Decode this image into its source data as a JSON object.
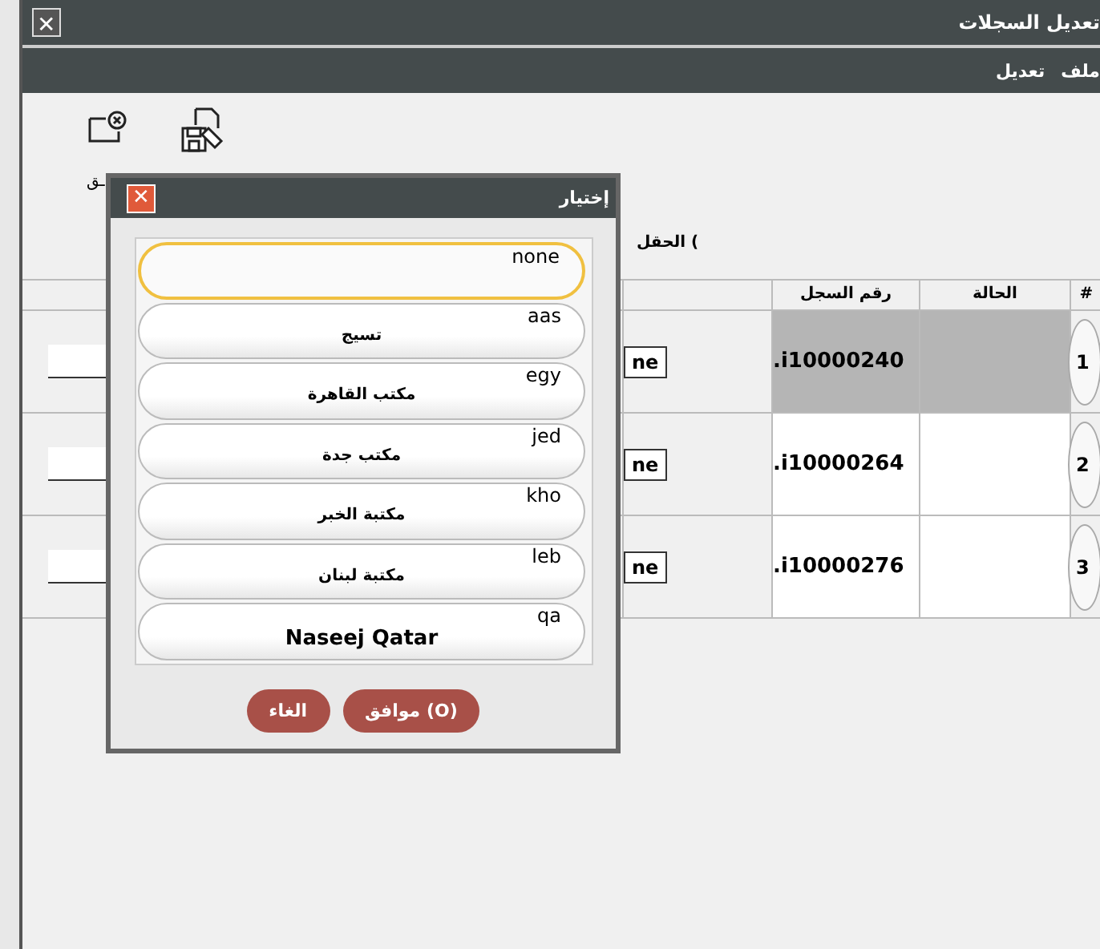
{
  "window": {
    "title": "تعديل السجلات",
    "close": "✕"
  },
  "menu": [
    {
      "label": "ملف"
    },
    {
      "label": "تعديل"
    }
  ],
  "toolbar": {
    "label": "ـق"
  },
  "field_label": "الحقل (",
  "table": {
    "columns": [
      "#",
      "الحالة",
      "رقم السجل"
    ],
    "rows": [
      {
        "number": "1",
        "status": "",
        "record": "i10000240.",
        "button": "ne",
        "selected": true
      },
      {
        "number": "2",
        "status": "",
        "record": "i10000264.",
        "button": "ne",
        "selected": false
      },
      {
        "number": "3",
        "status": "",
        "record": "i10000276.",
        "button": "ne",
        "selected": false
      }
    ]
  },
  "dialog": {
    "title": "إختيار",
    "close": "✕",
    "items": [
      {
        "code": "none",
        "selected": true
      },
      {
        "code": "aas",
        "name": "تسيج",
        "selected": false
      },
      {
        "code": "egy",
        "name": "مكتب القاهرة",
        "selected": false
      },
      {
        "code": "jed",
        "name": "مكتب جدة",
        "selected": false
      },
      {
        "code": "kho",
        "name": "مكتبة الخبر",
        "selected": false
      },
      {
        "code": "leb",
        "name": "مكتبة لبنان",
        "selected": false
      },
      {
        "code": "qa",
        "name": "Naseej Qatar",
        "selected": false
      }
    ],
    "buttons": [
      {
        "label": "موافق (O)"
      },
      {
        "label": "الغاء"
      }
    ]
  }
}
